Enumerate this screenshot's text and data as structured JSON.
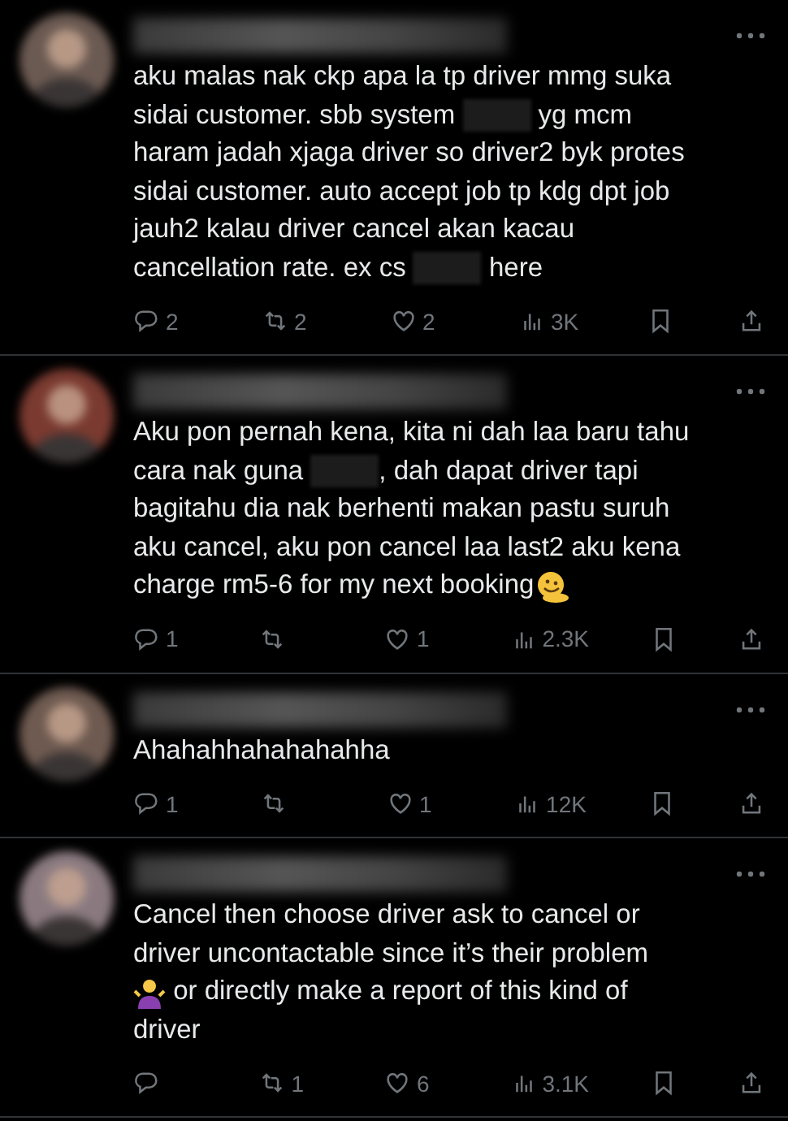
{
  "replies": [
    {
      "avatar": {
        "kind": "picture"
      },
      "lines": [
        [
          {
            "kind": "text",
            "text": "aku malas nak ckp apa la tp driver mmg suka"
          }
        ],
        [
          {
            "kind": "text",
            "text": "sidai customer. sbb system "
          },
          {
            "kind": "redacted"
          },
          {
            "kind": "text",
            "text": " yg mcm"
          }
        ],
        [
          {
            "kind": "text",
            "text": "haram jadah xjaga driver so driver2 byk protes"
          }
        ],
        [
          {
            "kind": "text",
            "text": "sidai customer. auto accept job tp kdg dpt job"
          }
        ],
        [
          {
            "kind": "text",
            "text": "jauh2 kalau driver cancel akan kacau"
          }
        ],
        [
          {
            "kind": "text",
            "text": "cancellation rate. ex cs "
          },
          {
            "kind": "redacted"
          },
          {
            "kind": "text",
            "text": " here"
          }
        ]
      ],
      "replies": "2",
      "reposts": "2",
      "likes": "2",
      "views": "3K"
    },
    {
      "avatar": {
        "kind": "picture"
      },
      "lines": [
        [
          {
            "kind": "text",
            "text": "Aku pon pernah kena, kita ni dah laa baru tahu"
          }
        ],
        [
          {
            "kind": "text",
            "text": "cara nak guna "
          },
          {
            "kind": "redacted"
          },
          {
            "kind": "text",
            "text": ", dah dapat driver tapi"
          }
        ],
        [
          {
            "kind": "text",
            "text": "bagitahu dia nak berhenti makan pastu suruh"
          }
        ],
        [
          {
            "kind": "text",
            "text": "aku cancel, aku pon cancel laa last2 aku kena"
          }
        ],
        [
          {
            "kind": "text",
            "text": "charge rm5-6 for my next booking"
          },
          {
            "kind": "emoji_melting"
          }
        ]
      ],
      "replies": "1",
      "likes": "1",
      "views": "2.3K"
    },
    {
      "avatar": {
        "kind": "picture"
      },
      "lines": [
        [
          {
            "kind": "text",
            "text": "Ahahahhahahahahha"
          }
        ]
      ],
      "replies": "1",
      "likes": "1",
      "views": "12K"
    },
    {
      "avatar": {
        "kind": "picture"
      },
      "lines": [
        [
          {
            "kind": "text",
            "text": "Cancel then choose driver ask to cancel or"
          }
        ],
        [
          {
            "kind": "text",
            "text": "driver uncontactable since it’s their problem"
          }
        ],
        [
          {
            "kind": "emoji_shrug"
          },
          {
            "kind": "text",
            "text": " or directly make a report of this kind of"
          }
        ],
        [
          {
            "kind": "text",
            "text": "driver"
          }
        ]
      ],
      "reposts": "1",
      "likes": "6",
      "views": "3.1K"
    }
  ]
}
